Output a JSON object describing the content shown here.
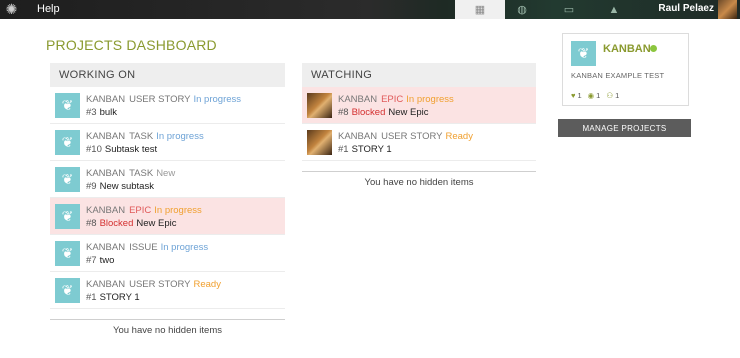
{
  "topbar": {
    "help_label": "Help",
    "user_name": "Raul Pelaez",
    "nav": [
      {
        "icon": "dashboard-grid-icon",
        "active": true
      },
      {
        "icon": "discover-globe-icon",
        "active": false
      },
      {
        "icon": "inbox-icon",
        "active": false
      },
      {
        "icon": "notifications-bell-icon",
        "active": false
      }
    ]
  },
  "page_title": "PROJECTS DASHBOARD",
  "working_on": {
    "header": "WORKING ON",
    "items": [
      {
        "project": "KANBAN",
        "type": "USER STORY",
        "status": "In progress",
        "ref": "#3",
        "blocked": "",
        "subject": "bulk"
      },
      {
        "project": "KANBAN",
        "type": "TASK",
        "status": "In progress",
        "ref": "#10",
        "blocked": "",
        "subject": "Subtask test"
      },
      {
        "project": "KANBAN",
        "type": "TASK",
        "status": "New",
        "ref": "#9",
        "blocked": "",
        "subject": "New subtask"
      },
      {
        "project": "KANBAN",
        "type": "EPIC",
        "status": "In progress",
        "ref": "#8",
        "blocked": "Blocked",
        "subject": "New Epic"
      },
      {
        "project": "KANBAN",
        "type": "ISSUE",
        "status": "In progress",
        "ref": "#7",
        "blocked": "",
        "subject": "two"
      },
      {
        "project": "KANBAN",
        "type": "USER STORY",
        "status": "Ready",
        "ref": "#1",
        "blocked": "",
        "subject": "STORY 1"
      }
    ],
    "hidden_note": "You have no hidden items"
  },
  "watching": {
    "header": "WATCHING",
    "items": [
      {
        "project": "KANBAN",
        "type": "EPIC",
        "status": "In progress",
        "ref": "#8",
        "blocked": "Blocked",
        "subject": "New Epic"
      },
      {
        "project": "KANBAN",
        "type": "USER STORY",
        "status": "Ready",
        "ref": "#1",
        "blocked": "",
        "subject": "STORY 1"
      }
    ],
    "hidden_note": "You have no hidden items"
  },
  "project_card": {
    "name": "KANBAN",
    "description": "KANBAN EXAMPLE TEST",
    "likes": "1",
    "watchers": "1",
    "members": "1"
  },
  "manage_button": "MANAGE PROJECTS",
  "colors": {
    "accent": "#8a9a2f",
    "blocked_bg": "#fbe3e3",
    "status_progress": "#6ea3d6",
    "status_ready": "#f0a030",
    "blocked_text": "#d43030"
  }
}
